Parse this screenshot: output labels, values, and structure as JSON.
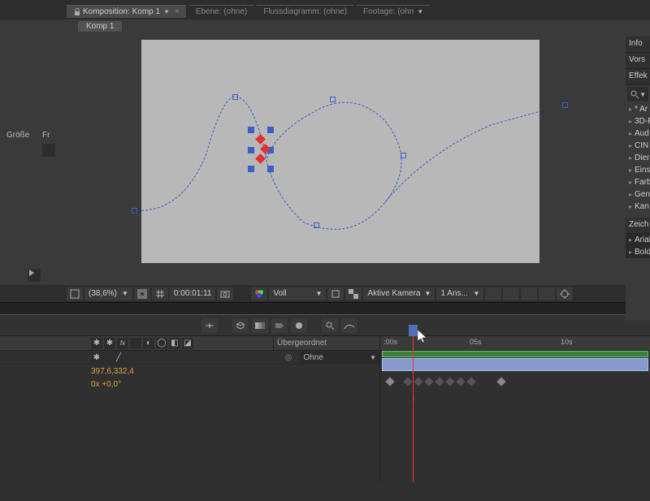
{
  "tabs": {
    "main": "Komposition: Komp 1",
    "layer": "Ebene: (ohne)",
    "flow": "Flussdiagramm: (ohne)",
    "footage": "Footage: (ohn"
  },
  "subtab": "Komp 1",
  "leftColumn": {
    "size": "Größe",
    "fr": "Fr"
  },
  "viewerBar": {
    "zoom": "(38,6%)",
    "time": "0:00:01:11",
    "res": "Voll",
    "camera": "Aktive Kamera",
    "views": "1 Ans..."
  },
  "rpanel": {
    "info": "Info",
    "vors": "Vors",
    "effects": "Effek",
    "items": [
      "* Ar",
      "3D-F",
      "Aud",
      "CIN",
      "Dier",
      "Eins",
      "Farb",
      "Gen",
      "Kan"
    ],
    "zeich": "Zeich",
    "font": "Arial",
    "weight": "Bold"
  },
  "timeline": {
    "parentHeader": "Übergeordnet",
    "parentValue": "Ohne",
    "pos": "397,6,332,4",
    "rot": "0x +0,0°",
    "ticks": [
      ":00s",
      "05s",
      "10s"
    ]
  }
}
